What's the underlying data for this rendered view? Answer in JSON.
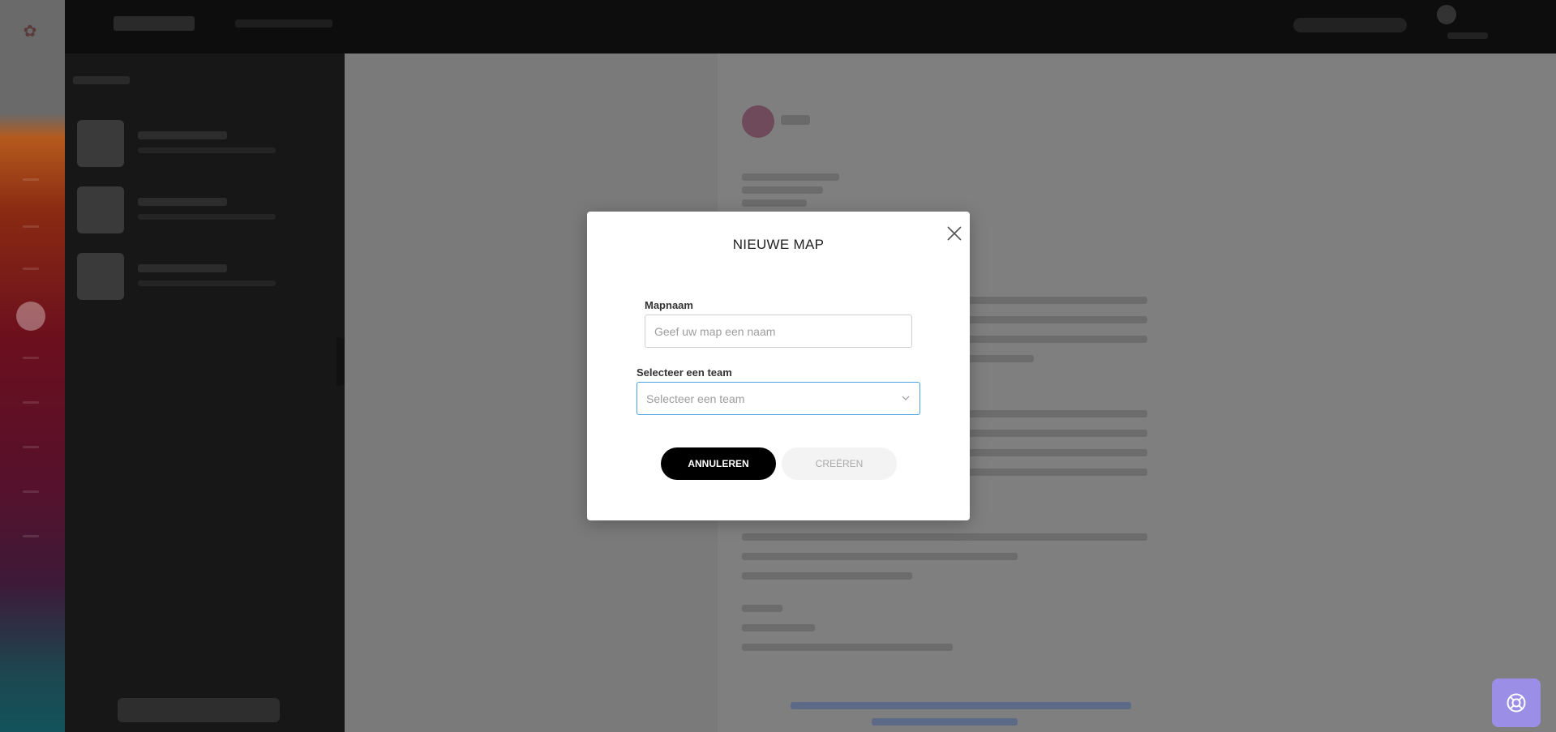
{
  "modal": {
    "title": "NIEUWE MAP",
    "folder_name_label": "Mapnaam",
    "folder_name_placeholder": "Geef uw map een naam",
    "folder_name_value": "",
    "team_label": "Selecteer een team",
    "team_placeholder": "Selecteer een team",
    "cancel_label": "ANNULEREN",
    "create_label": "CREËREN",
    "close_icon": "close-icon"
  },
  "help": {
    "icon": "lifebuoy-icon"
  },
  "colors": {
    "accent_select_border": "#4aa3df",
    "cancel_button_bg": "#000000",
    "create_button_bg": "#f3f3f3",
    "help_button_bg": "#9b8ee6"
  }
}
